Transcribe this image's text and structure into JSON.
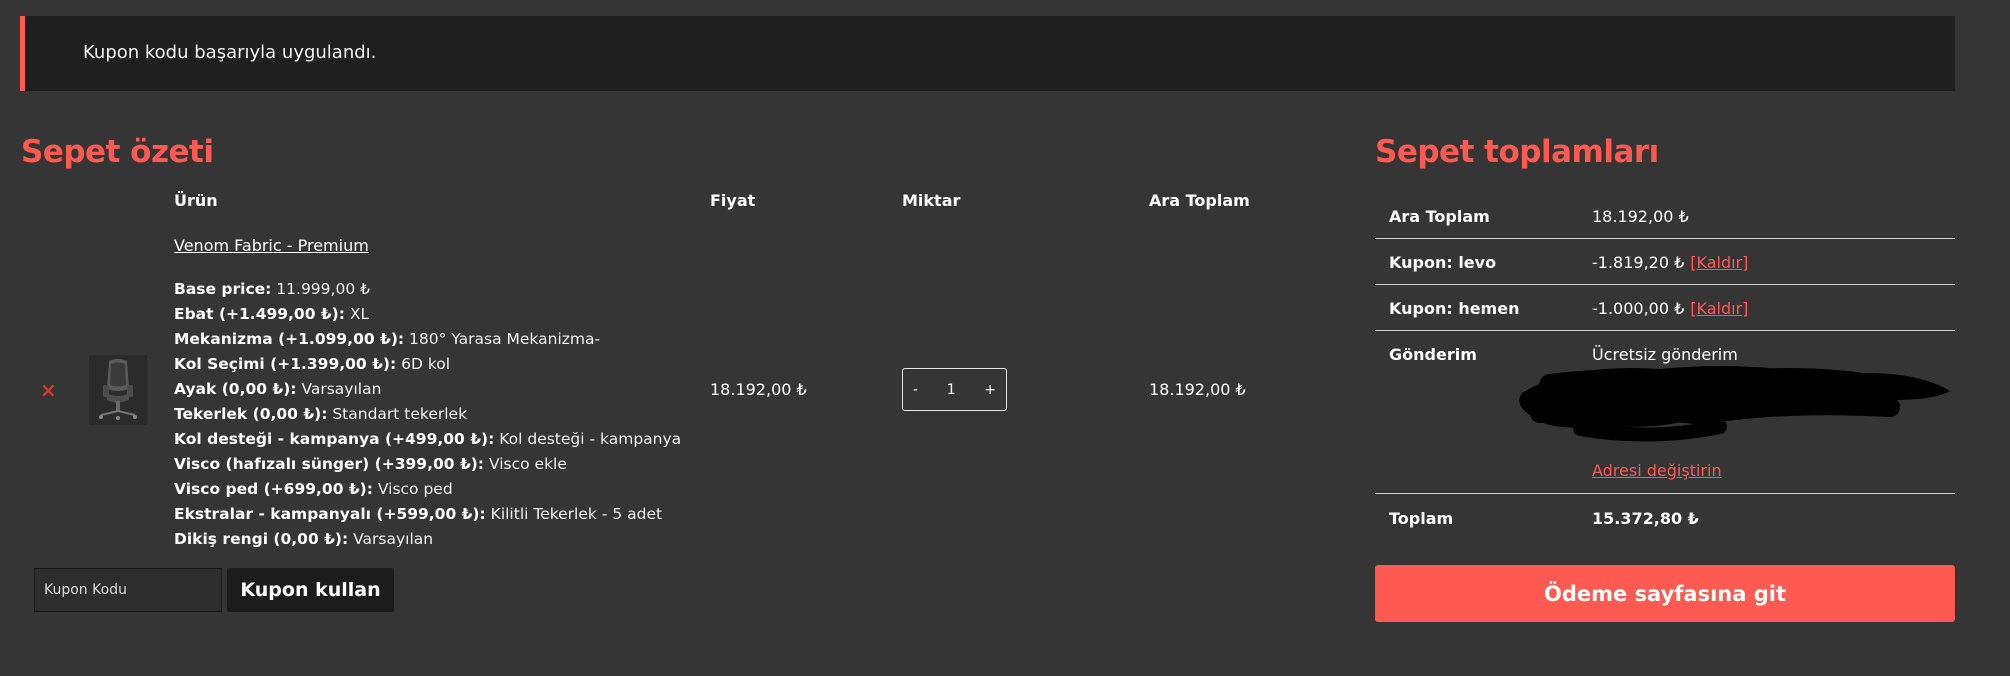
{
  "notice": {
    "text": "Kupon kodu başarıyla uygulandı."
  },
  "cart": {
    "title": "Sepet özeti",
    "headers": {
      "product": "Ürün",
      "price": "Fiyat",
      "quantity": "Miktar",
      "subtotal": "Ara Toplam"
    },
    "item": {
      "name": "Venom Fabric - Premium",
      "meta": [
        {
          "key": "Base price:",
          "value": "11.999,00 ₺"
        },
        {
          "key": "Ebat (+1.499,00 ₺):",
          "value": "XL"
        },
        {
          "key": "Mekanizma (+1.099,00 ₺):",
          "value": "180° Yarasa Mekanizma-"
        },
        {
          "key": "Kol Seçimi (+1.399,00 ₺):",
          "value": "6D kol"
        },
        {
          "key": "Ayak (0,00 ₺):",
          "value": "Varsayılan"
        },
        {
          "key": "Tekerlek (0,00 ₺):",
          "value": "Standart tekerlek"
        },
        {
          "key": "Kol desteği - kampanya (+499,00 ₺):",
          "value": "Kol desteği - kampanya"
        },
        {
          "key": "Visco (hafızalı sünger) (+399,00 ₺):",
          "value": "Visco ekle"
        },
        {
          "key": "Visco ped (+699,00 ₺):",
          "value": "Visco ped"
        },
        {
          "key": "Ekstralar - kampanyalı (+599,00 ₺):",
          "value": "Kilitli Tekerlek - 5 adet"
        },
        {
          "key": "Dikiş rengi (0,00 ₺):",
          "value": "Varsayılan"
        }
      ],
      "price": "18.192,00 ₺",
      "quantity": "1",
      "subtotal": "18.192,00 ₺",
      "remove_icon": "×"
    },
    "coupon": {
      "placeholder": "Kupon Kodu",
      "button": "Kupon kullan"
    }
  },
  "totals": {
    "title": "Sepet toplamları",
    "subtotal": {
      "label": "Ara Toplam",
      "value": "18.192,00 ₺"
    },
    "coupons": [
      {
        "label": "Kupon: levo",
        "value": "-1.819,20 ₺",
        "remove": "[Kaldır]"
      },
      {
        "label": "Kupon: hemen",
        "value": "-1.000,00 ₺",
        "remove": "[Kaldır]"
      }
    ],
    "shipping": {
      "label": "Gönderim",
      "value": "Ücretsiz gönderim",
      "change_address": "Adresi değiştirin"
    },
    "total": {
      "label": "Toplam",
      "value": "15.372,80 ₺"
    },
    "checkout": "Ödeme sayfasına git"
  },
  "colors": {
    "accent": "#ff5a52",
    "background": "#353535",
    "notice_bg": "#1f1f1f"
  },
  "icons": {
    "remove": "close-icon",
    "product": "chair-thumbnail"
  }
}
